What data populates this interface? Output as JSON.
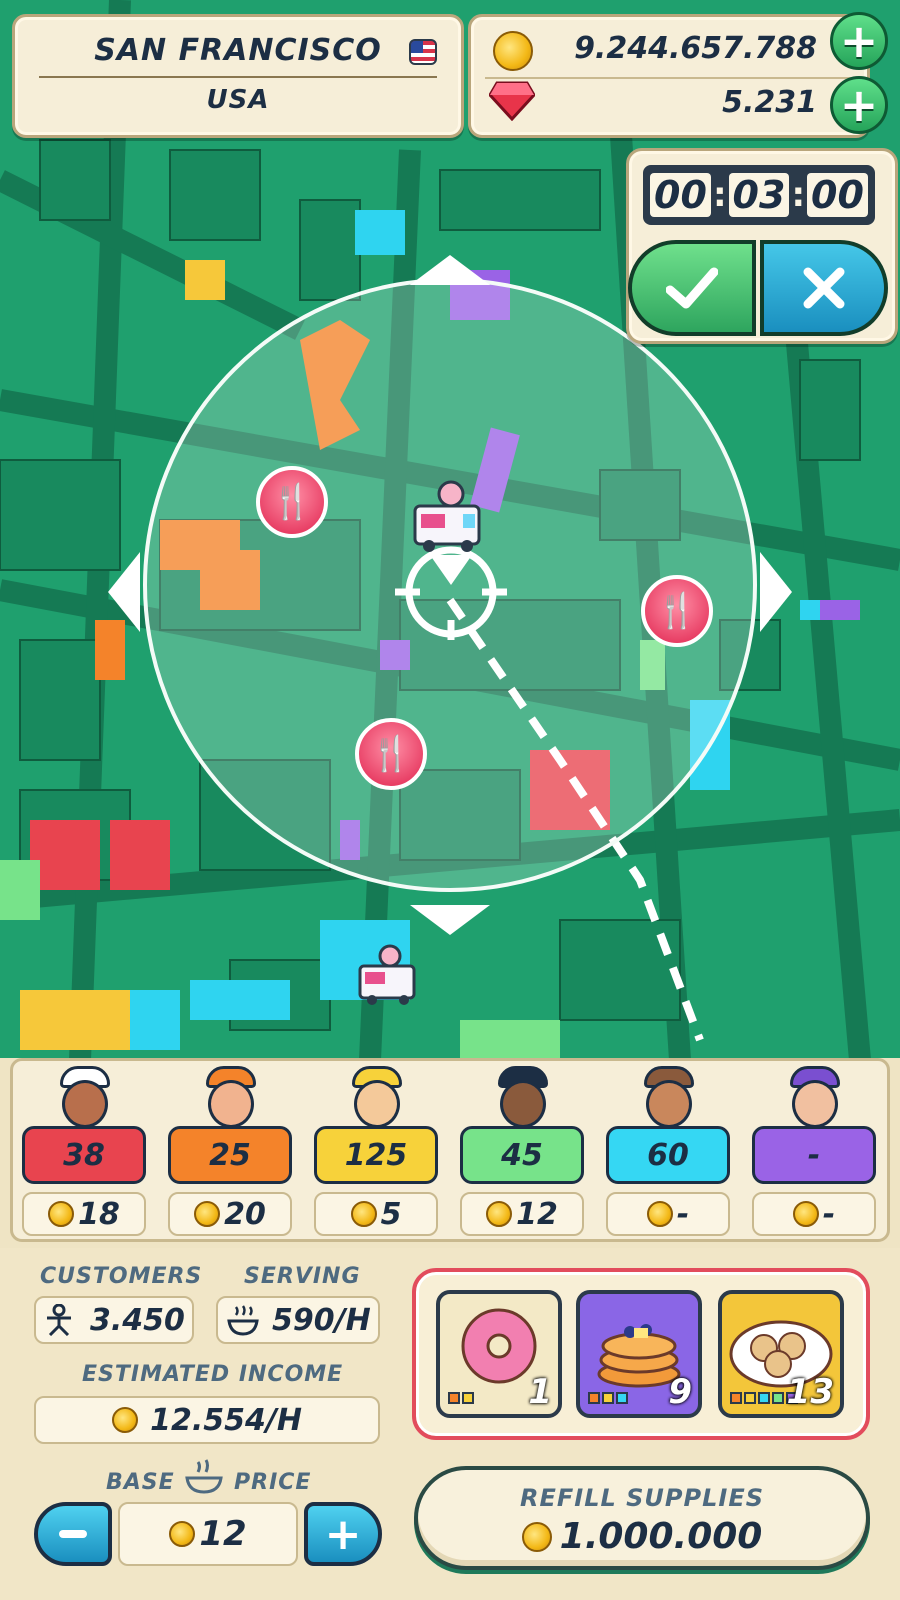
{
  "location": {
    "city": "SAN FRANCISCO",
    "country": "USA"
  },
  "currency": {
    "coins": "9.244.657.788",
    "gems": "5.231"
  },
  "timer": {
    "h": "00",
    "m": "03",
    "s": "00"
  },
  "characters": [
    {
      "count": "38",
      "price": "18",
      "color": "#e8444f"
    },
    {
      "count": "25",
      "price": "20",
      "color": "#f4832a"
    },
    {
      "count": "125",
      "price": "5",
      "color": "#f7d23a"
    },
    {
      "count": "45",
      "price": "12",
      "color": "#77e38a"
    },
    {
      "count": "60",
      "price": "-",
      "color": "#35d7f3"
    },
    {
      "count": "-",
      "price": "-",
      "color": "#9a63e6"
    }
  ],
  "stats": {
    "customers_label": "CUSTOMERS",
    "customers_value": "3.450",
    "serving_label": "SERVING",
    "serving_value": "590/H",
    "income_label": "ESTIMATED INCOME",
    "income_value": "12.554/",
    "income_unit": "H",
    "base_label": "BASE",
    "price_label": "PRICE",
    "price_value": "12"
  },
  "foods": [
    {
      "name": "donut-icon",
      "count": "1"
    },
    {
      "name": "pancakes-icon",
      "count": "9"
    },
    {
      "name": "cookies-icon",
      "count": "13"
    }
  ],
  "refill": {
    "label": "REFILL SUPPLIES",
    "cost": "1.000.000"
  }
}
